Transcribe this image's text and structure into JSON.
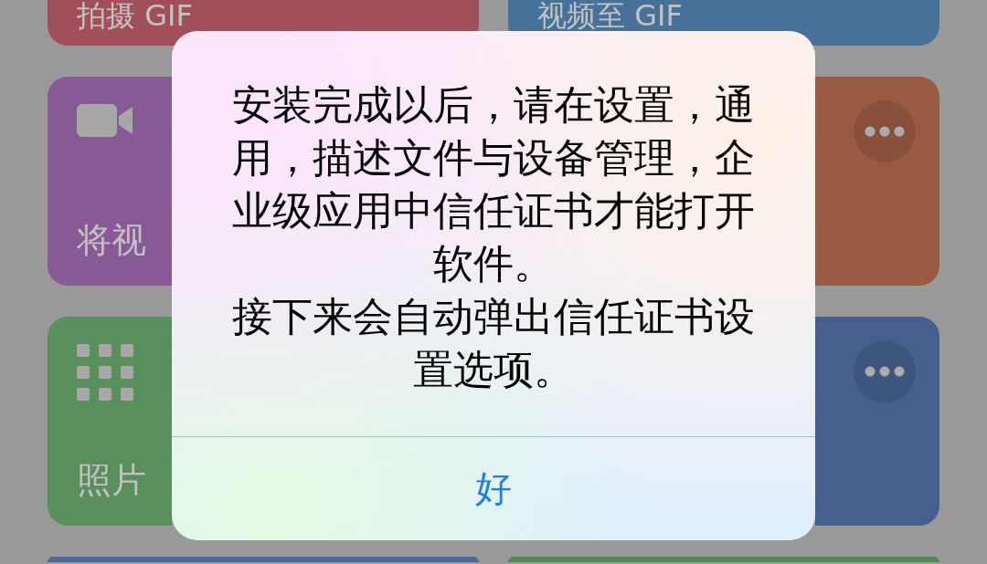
{
  "tiles": [
    {
      "title": "拍摄 GIF",
      "color": "#a24f5c"
    },
    {
      "title": "视频至 GIF",
      "color": "#46729a"
    },
    {
      "title": "将视",
      "color": "#875a96"
    },
    {
      "color": "#995a44",
      "menu_button": true
    },
    {
      "title": "照片",
      "color": "#588f5c"
    },
    {
      "color": "#465f8c",
      "menu_button": true
    },
    {
      "color": "#4a6a9a"
    },
    {
      "color": "#4f8a55"
    }
  ],
  "alert": {
    "message": [
      "安装完成以后，请在设置，通用，描述文件与设备管理，企业级应用中信任证书才能打开软件。",
      "接下来会自动弹出信任证书设置选项。"
    ],
    "button": "好"
  }
}
